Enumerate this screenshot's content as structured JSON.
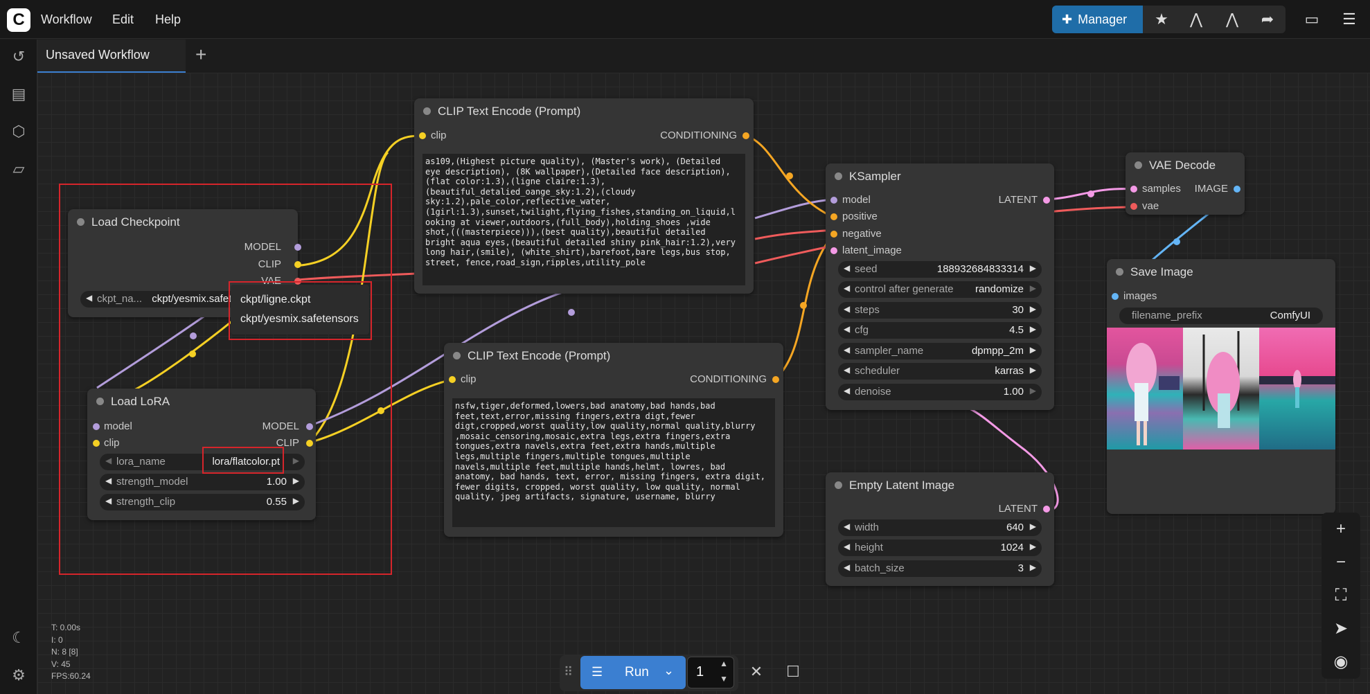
{
  "menu": {
    "workflow": "Workflow",
    "edit": "Edit",
    "help": "Help"
  },
  "toolbar": {
    "manager": "Manager"
  },
  "tabs": {
    "active": "Unsaved Workflow"
  },
  "nodes": {
    "load_checkpoint": {
      "title": "Load Checkpoint",
      "out_model": "MODEL",
      "out_clip": "CLIP",
      "out_vae": "VAE",
      "ckpt_label": "ckpt_na...",
      "ckpt_value": "ckpt/yesmix.safeten"
    },
    "dropdown": {
      "option1": "ckpt/ligne.ckpt",
      "option2": "ckpt/yesmix.safetensors"
    },
    "load_lora": {
      "title": "Load LoRA",
      "in_model": "model",
      "in_clip": "clip",
      "out_model": "MODEL",
      "out_clip": "CLIP",
      "lora_name_label": "lora_name",
      "lora_name_value": "lora/flatcolor.pt",
      "strength_model_label": "strength_model",
      "strength_model_value": "1.00",
      "strength_clip_label": "strength_clip",
      "strength_clip_value": "0.55"
    },
    "clip_pos": {
      "title": "CLIP Text Encode (Prompt)",
      "in_clip": "clip",
      "out": "CONDITIONING",
      "text": "as109,(Highest picture quality), (Master's work), (Detailed\neye description), (8K wallpaper),(Detailed face description),\n(flat color:1.3),(ligne claire:1.3),\n(beautiful_detalied_oange_sky:1.2),(cloudy\nsky:1.2),pale_color,reflective_water,\n(1girl:1.3),sunset,twilight,flying_fishes,standing_on_liquid,l\nooking at viewer,outdoors,(full_body),holding_shoes ,wide\nshot,(((masterpiece))),(best quality),beautiful detailed\nbright aqua eyes,(beautiful detailed shiny pink_hair:1.2),very\nlong hair,(smile), (white_shirt),barefoot,bare legs,bus stop,\nstreet, fence,road_sign,ripples,utility_pole"
    },
    "clip_neg": {
      "title": "CLIP Text Encode (Prompt)",
      "in_clip": "clip",
      "out": "CONDITIONING",
      "text": "nsfw,tiger,deformed,lowers,bad anatomy,bad hands,bad\nfeet,text,error,missing fingers,extra digt,fewer\ndigt,cropped,worst quality,low quality,normal quality,blurry\n,mosaic_censoring,mosaic,extra legs,extra fingers,extra\ntongues,extra navels,extra feet,extra hands,multiple\nlegs,multiple fingers,multiple tongues,multiple\nnavels,multiple feet,multiple hands,helmt, lowres, bad\nanatomy, bad hands, text, error, missing fingers, extra digit,\nfewer digits, cropped, worst quality, low quality, normal\nquality, jpeg artifacts, signature, username, blurry"
    },
    "ksampler": {
      "title": "KSampler",
      "in_model": "model",
      "in_positive": "positive",
      "in_negative": "negative",
      "in_latent": "latent_image",
      "out": "LATENT",
      "widgets": [
        {
          "label": "seed",
          "value": "188932684833314"
        },
        {
          "label": "control after generate",
          "value": "randomize"
        },
        {
          "label": "steps",
          "value": "30"
        },
        {
          "label": "cfg",
          "value": "4.5"
        },
        {
          "label": "sampler_name",
          "value": "dpmpp_2m"
        },
        {
          "label": "scheduler",
          "value": "karras"
        },
        {
          "label": "denoise",
          "value": "1.00"
        }
      ]
    },
    "vae_decode": {
      "title": "VAE Decode",
      "in_samples": "samples",
      "in_vae": "vae",
      "out": "IMAGE"
    },
    "save_image": {
      "title": "Save Image",
      "in_images": "images",
      "prefix_label": "filename_prefix",
      "prefix_value": "ComfyUI"
    },
    "empty_latent": {
      "title": "Empty Latent Image",
      "out": "LATENT",
      "widgets": [
        {
          "label": "width",
          "value": "640"
        },
        {
          "label": "height",
          "value": "1024"
        },
        {
          "label": "batch_size",
          "value": "3"
        }
      ]
    }
  },
  "stats": {
    "t": "T: 0.00s",
    "i": "I: 0",
    "n": "N: 8 [8]",
    "v": "V: 45",
    "fps": "FPS:60.24"
  },
  "run": {
    "label": "Run",
    "count": "1"
  },
  "colors": {
    "clip": "#f5d024",
    "model": "#b39ddb",
    "vae": "#ef5b5b",
    "conditioning": "#f5a623",
    "latent": "#f49ae6",
    "image": "#64b5f6",
    "accent": "#3b7fd1",
    "highlight": "#d6252b"
  }
}
